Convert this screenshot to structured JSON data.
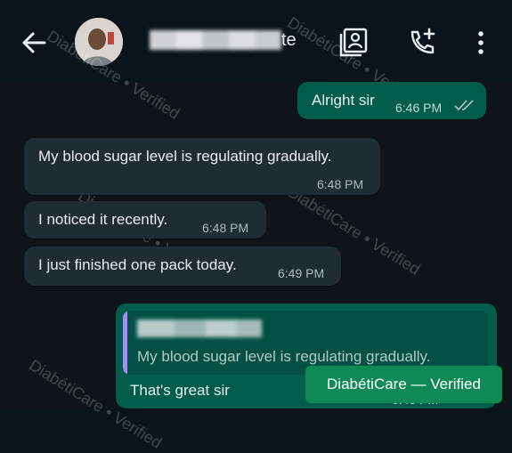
{
  "header": {
    "contact_name_suffix": "te",
    "back_icon": "arrow-left-icon",
    "contacts_icon": "contact-card-icon",
    "call_icon": "add-call-icon",
    "menu_icon": "more-vertical-icon"
  },
  "messages": [
    {
      "direction": "out",
      "text": "Alright sir",
      "time": "6:46 PM",
      "status": "read-double-tick-icon"
    },
    {
      "direction": "in",
      "text": "My blood sugar level is regulating  gradually.",
      "time": "6:48 PM"
    },
    {
      "direction": "in",
      "text": "I noticed it recently.",
      "time": "6:48 PM"
    },
    {
      "direction": "in",
      "text": "I just finished one pack today.",
      "time": "6:49 PM"
    },
    {
      "direction": "out",
      "quoted_text": "My blood sugar level is regulating  gradually.",
      "text": "That's great sir",
      "time": "6:49 PM"
    }
  ],
  "watermark": {
    "text": "DiabétiCare • Verified"
  },
  "badge": {
    "text": "DiabétiCare — Verified"
  },
  "colors": {
    "background": "#0b141a",
    "incoming_bubble": "#1f2c34",
    "outgoing_bubble": "#005c4b",
    "badge": "#0f8a56",
    "quote_bar": "#a78bfa"
  }
}
